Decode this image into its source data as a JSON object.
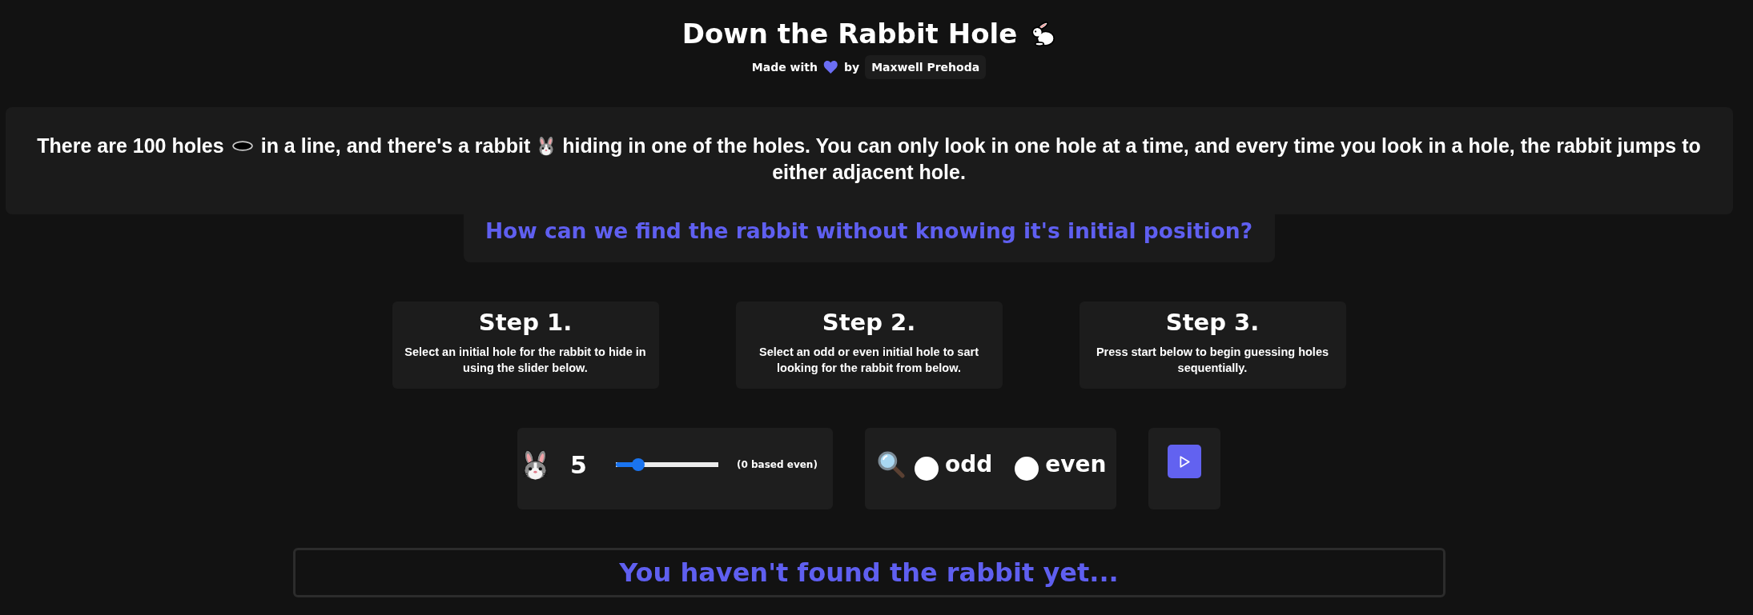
{
  "header": {
    "title": "Down the Rabbit Hole",
    "credit": {
      "prefix": "Made with",
      "joiner": "by",
      "author": "Maxwell Prehoda"
    }
  },
  "intro": {
    "lines": [
      [
        "There are 100 holes",
        "in a line, and there's a rabbit",
        "hiding in one of the holes. You can only look in one hole at a time, and every time you look in a hole, the rabbit jumps to"
      ],
      [
        "either adjacent hole."
      ]
    ]
  },
  "question": "How can we find the rabbit without knowing it's initial position?",
  "steps": [
    {
      "title": "Step 1.",
      "text": "Select an initial hole for the rabbit to hide in using the slider below."
    },
    {
      "title": "Step 2.",
      "text": "Select an odd or even initial hole to sart looking for the rabbit from below."
    },
    {
      "title": "Step 3.",
      "text": "Press start below to begin guessing holes sequentially."
    }
  ],
  "controls": {
    "position": {
      "value": "5",
      "level": 0.18,
      "note": "(0 based even)"
    },
    "parity": {
      "options": [
        {
          "label": "odd",
          "selected": false
        },
        {
          "label": "even",
          "selected": false
        }
      ]
    }
  },
  "status": "You haven't found the rabbit yet..."
}
